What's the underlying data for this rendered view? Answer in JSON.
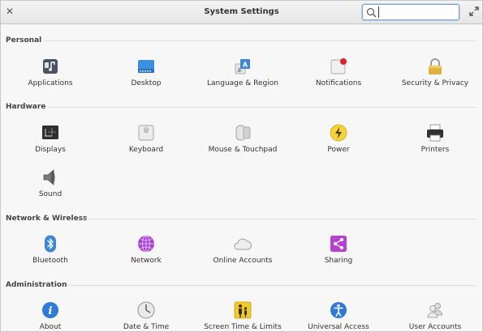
{
  "window": {
    "title": "System Settings",
    "search_value": ""
  },
  "sections": [
    {
      "label": "Personal",
      "items": [
        {
          "label": "Applications",
          "icon": "applications-icon"
        },
        {
          "label": "Desktop",
          "icon": "desktop-icon"
        },
        {
          "label": "Language & Region",
          "icon": "language-region-icon"
        },
        {
          "label": "Notifications",
          "icon": "notifications-icon"
        },
        {
          "label": "Security & Privacy",
          "icon": "security-privacy-icon"
        }
      ]
    },
    {
      "label": "Hardware",
      "items": [
        {
          "label": "Displays",
          "icon": "displays-icon"
        },
        {
          "label": "Keyboard",
          "icon": "keyboard-icon"
        },
        {
          "label": "Mouse & Touchpad",
          "icon": "mouse-touchpad-icon"
        },
        {
          "label": "Power",
          "icon": "power-icon"
        },
        {
          "label": "Printers",
          "icon": "printers-icon"
        },
        {
          "label": "Sound",
          "icon": "sound-icon"
        }
      ]
    },
    {
      "label": "Network & Wireless",
      "items": [
        {
          "label": "Bluetooth",
          "icon": "bluetooth-icon"
        },
        {
          "label": "Network",
          "icon": "network-icon"
        },
        {
          "label": "Online Accounts",
          "icon": "online-accounts-icon"
        },
        {
          "label": "Sharing",
          "icon": "sharing-icon"
        }
      ]
    },
    {
      "label": "Administration",
      "items": [
        {
          "label": "About",
          "icon": "about-icon"
        },
        {
          "label": "Date & Time",
          "icon": "date-time-icon"
        },
        {
          "label": "Screen Time & Limits",
          "icon": "screen-time-limits-icon"
        },
        {
          "label": "Universal Access",
          "icon": "universal-access-icon"
        },
        {
          "label": "User Accounts",
          "icon": "user-accounts-icon"
        }
      ]
    }
  ]
}
